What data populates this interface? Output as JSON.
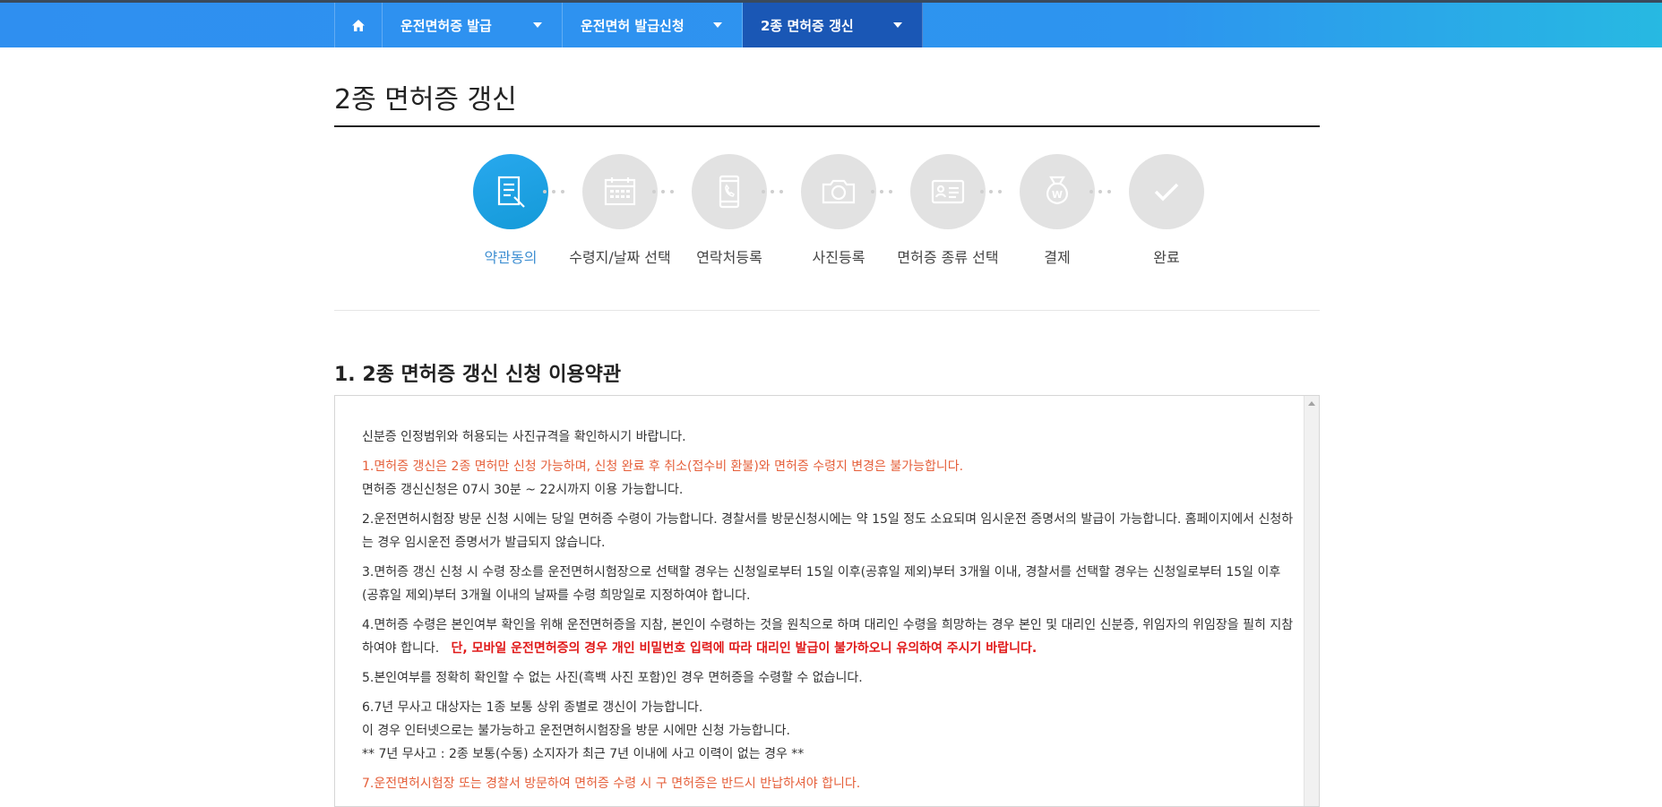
{
  "nav": {
    "items": [
      {
        "label": "운전면허증 발급"
      },
      {
        "label": "운전면허 발급신청"
      },
      {
        "label": "2종 면허증 갱신"
      }
    ]
  },
  "page": {
    "title": "2종 면허증 갱신"
  },
  "steps": [
    {
      "label": "약관동의",
      "icon": "document-pen-icon",
      "active": true
    },
    {
      "label": "수령지/날짜 선택",
      "icon": "calendar-icon",
      "active": false
    },
    {
      "label": "연락처등록",
      "icon": "phone-icon",
      "active": false
    },
    {
      "label": "사진등록",
      "icon": "camera-icon",
      "active": false
    },
    {
      "label": "면허증 종류 선택",
      "icon": "id-card-icon",
      "active": false
    },
    {
      "label": "결제",
      "icon": "money-bag-icon",
      "active": false
    },
    {
      "label": "완료",
      "icon": "check-icon",
      "active": false
    }
  ],
  "section": {
    "title": "1. 2종 면허증 갱신 신청 이용약관"
  },
  "terms": {
    "intro": "신분증 인정범위와 허용되는 사진규격을 확인하시기 바랍니다.",
    "p1_warning": "1.면허증 갱신은 2종 면허만 신청 가능하며, 신청 완료 후 취소(접수비 환불)와 면허증 수령지 변경은 불가능합니다.",
    "p1_hours": "면허증 갱신신청은 07시 30분 ~ 22시까지 이용 가능합니다.",
    "p2": "2.운전면허시험장 방문 신청 시에는 당일 면허증 수령이 가능합니다. 경찰서를 방문신청시에는 약 15일 정도 소요되며 임시운전 증명서의 발급이 가능합니다. 홈페이지에서 신청하는 경우 임시운전 증명서가 발급되지 않습니다.",
    "p3": "3.면허증 갱신 신청 시 수령 장소를 운전면허시험장으로 선택할 경우는 신청일로부터 15일 이후(공휴일 제외)부터 3개월 이내, 경찰서를 선택할 경우는 신청일로부터 15일 이후(공휴일 제외)부터 3개월 이내의 날짜를 수령 희망일로 지정하여야 합니다.",
    "p4": "4.면허증 수령은 본인여부 확인을 위해 운전면허증을 지참, 본인이 수령하는 것을 원칙으로 하며 대리인 수령을 희망하는 경우 본인 및 대리인 신분증, 위임자의 위임장을 필히 지참하여야 합니다.",
    "p4_warning": "단, 모바일 운전면허증의 경우 개인 비밀번호 입력에 따라 대리인 발급이 불가하오니 유의하여 주시기 바랍니다.",
    "p5": "5.본인여부를 정확히 확인할 수 없는 사진(흑백 사진 포함)인 경우 면허증을 수령할 수 없습니다.",
    "p6": "6.7년 무사고 대상자는 1종 보통 상위 종별로 갱신이 가능합니다.",
    "p6_line2": "이 경우 인터넷으로는 불가능하고 운전면허시험장을 방문 시에만 신청 가능합니다.",
    "p6_note": "** 7년 무사고 : 2종 보통(수동) 소지자가 최근 7년 이내에 사고 이력이 없는 경우 **",
    "p7_warning": "7.운전면허시험장 또는 경찰서 방문하여 면허증 수령 시 구 면허증은 반드시 반납하셔야 합니다."
  },
  "colors": {
    "nav_bg": "#2f8ff0",
    "nav_active": "#1a57b5",
    "step_active": "#1ea3e4",
    "step_inactive": "#e2e2e2",
    "warning_orange": "#e55f3a",
    "warning_red": "#e01919"
  }
}
